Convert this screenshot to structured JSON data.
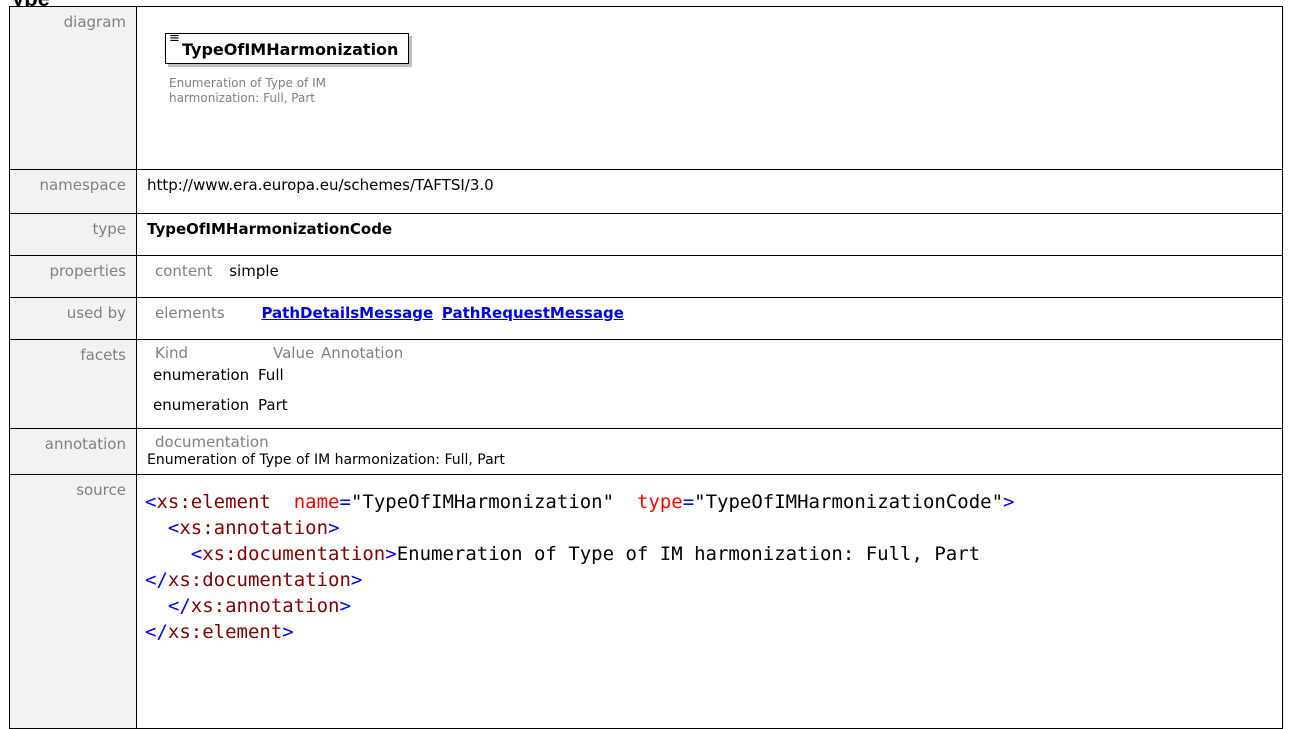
{
  "element": {
    "heading_cut": "ype",
    "labels": {
      "diagram": "diagram",
      "namespace": "namespace",
      "type": "type",
      "properties": "properties",
      "used_by": "used by",
      "facets": "facets",
      "annotation": "annotation",
      "source": "source"
    },
    "diagram": {
      "name": "TypeOfIMHarmonization",
      "icon": "enumeration-list-icon",
      "description_line1": "Enumeration of Type of IM",
      "description_line2": "harmonization: Full, Part"
    },
    "namespace": "http://www.era.europa.eu/schemes/TAFTSI/3.0",
    "type": "TypeOfIMHarmonizationCode",
    "properties": {
      "key": "content",
      "value": "simple"
    },
    "used_by": {
      "key": "elements",
      "links": [
        "PathDetailsMessage",
        "PathRequestMessage"
      ]
    },
    "facets": {
      "headers": [
        "Kind",
        "Value",
        "Annotation"
      ],
      "rows": [
        {
          "kind": "enumeration",
          "value": "Full"
        },
        {
          "kind": "enumeration",
          "value": "Part"
        }
      ]
    },
    "annotation": {
      "key": "documentation",
      "text": "Enumeration of Type of IM harmonization: Full, Part"
    },
    "source": {
      "lt": "<",
      "gt": ">",
      "close_lt": "</",
      "eq": "=",
      "el_tag": "xs:element",
      "attr_name": "name",
      "name_val": "\"TypeOfIMHarmonization\"",
      "attr_type": "type",
      "type_val": "\"TypeOfIMHarmonizationCode\"",
      "anno_tag": "xs:annotation",
      "doc_tag": "xs:documentation",
      "doc_text": "Enumeration of Type of IM harmonization: Full, Part"
    }
  }
}
